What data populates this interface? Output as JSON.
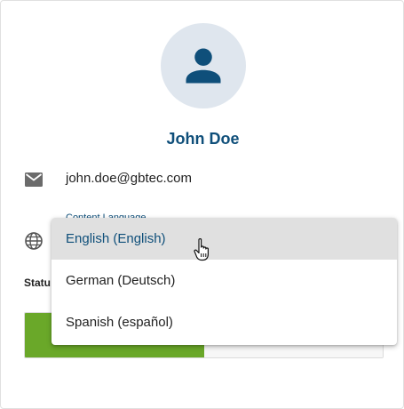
{
  "profile": {
    "name": "John Doe",
    "avatar_icon": "person-icon",
    "avatar_bg": "#dfe6ee",
    "avatar_fg": "#0f4f7a"
  },
  "email": {
    "icon": "email-icon",
    "value": "john.doe@gbtec.com"
  },
  "content_language": {
    "icon": "globe-icon",
    "label": "Content Language",
    "options": [
      {
        "label": "English (English)",
        "highlighted": true
      },
      {
        "label": "German (Deutsch)",
        "highlighted": false
      },
      {
        "label": "Spanish (español)",
        "highlighted": false
      }
    ]
  },
  "status": {
    "label": "Statu",
    "fill_fraction": 0.5,
    "active_color": "#6aa829"
  },
  "colors": {
    "accent": "#0f4f7a",
    "highlight_bg": "#e0e0e0"
  }
}
